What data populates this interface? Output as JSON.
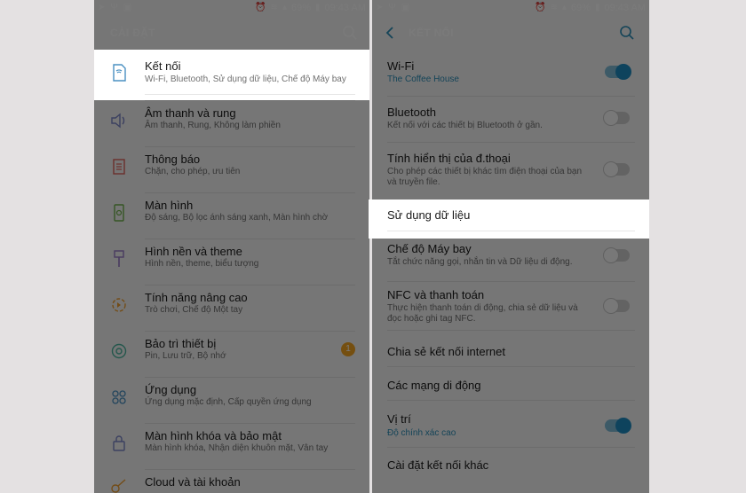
{
  "status": {
    "battery": "69%",
    "time": "09:43 AM"
  },
  "left": {
    "title": "CÀI ĐẶT",
    "items": [
      {
        "title": "Kết nối",
        "sub": "Wi-Fi, Bluetooth, Sử dụng dữ liệu, Chế độ Máy bay"
      },
      {
        "title": "Âm thanh và rung",
        "sub": "Âm thanh, Rung, Không làm phiền"
      },
      {
        "title": "Thông báo",
        "sub": "Chặn, cho phép, ưu tiên"
      },
      {
        "title": "Màn hình",
        "sub": "Độ sáng, Bộ lọc ánh sáng xanh, Màn hình chờ"
      },
      {
        "title": "Hình nền và theme",
        "sub": "Hình nền, theme, biểu tượng"
      },
      {
        "title": "Tính năng nâng cao",
        "sub": "Trò chơi, Chế độ Một tay"
      },
      {
        "title": "Bảo trì thiết bị",
        "sub": "Pin, Lưu trữ, Bộ nhớ",
        "badge": "1"
      },
      {
        "title": "Ứng dụng",
        "sub": "Ứng dụng mặc định, Cấp quyền ứng dụng"
      },
      {
        "title": "Màn hình khóa và bảo mật",
        "sub": "Màn hình khóa, Nhận diện khuôn mặt, Vân tay"
      },
      {
        "title": "Cloud và tài khoản",
        "sub": ""
      }
    ]
  },
  "right": {
    "title": "KẾT NỐI",
    "items": [
      {
        "title": "Wi-Fi",
        "sub": "The Coffee House"
      },
      {
        "title": "Bluetooth",
        "sub": "Kết nối với các thiết bị Bluetooth ở gần."
      },
      {
        "title": "Tính hiển thị của đ.thoại",
        "sub1": "Cho phép các thiết bị khác tìm điện thoại của bạn",
        "sub2": "và truyền file."
      },
      {
        "title": "Sử dụng dữ liệu"
      },
      {
        "title": "Chế độ Máy bay",
        "sub": "Tắt chức năng gọi, nhắn tin và Dữ liệu di động."
      },
      {
        "title": "NFC và thanh toán",
        "sub1": "Thực hiện thanh toán di động, chia sẻ dữ liệu và",
        "sub2": "đọc hoặc ghi tag NFC."
      },
      {
        "title": "Chia sẻ kết nối internet"
      },
      {
        "title": "Các mạng di động"
      },
      {
        "title": "Vị trí",
        "sub": "Độ chính xác cao"
      },
      {
        "title": "Cài đặt kết nối khác"
      }
    ]
  },
  "toggles": {
    "wifi": true,
    "bluetooth": false,
    "visibility": false,
    "airplane": false,
    "nfc": false,
    "location": true
  },
  "colors": {
    "accent": "#2b8eb8",
    "toggle_on": "#1e8dc2",
    "badge": "#f5a623"
  }
}
